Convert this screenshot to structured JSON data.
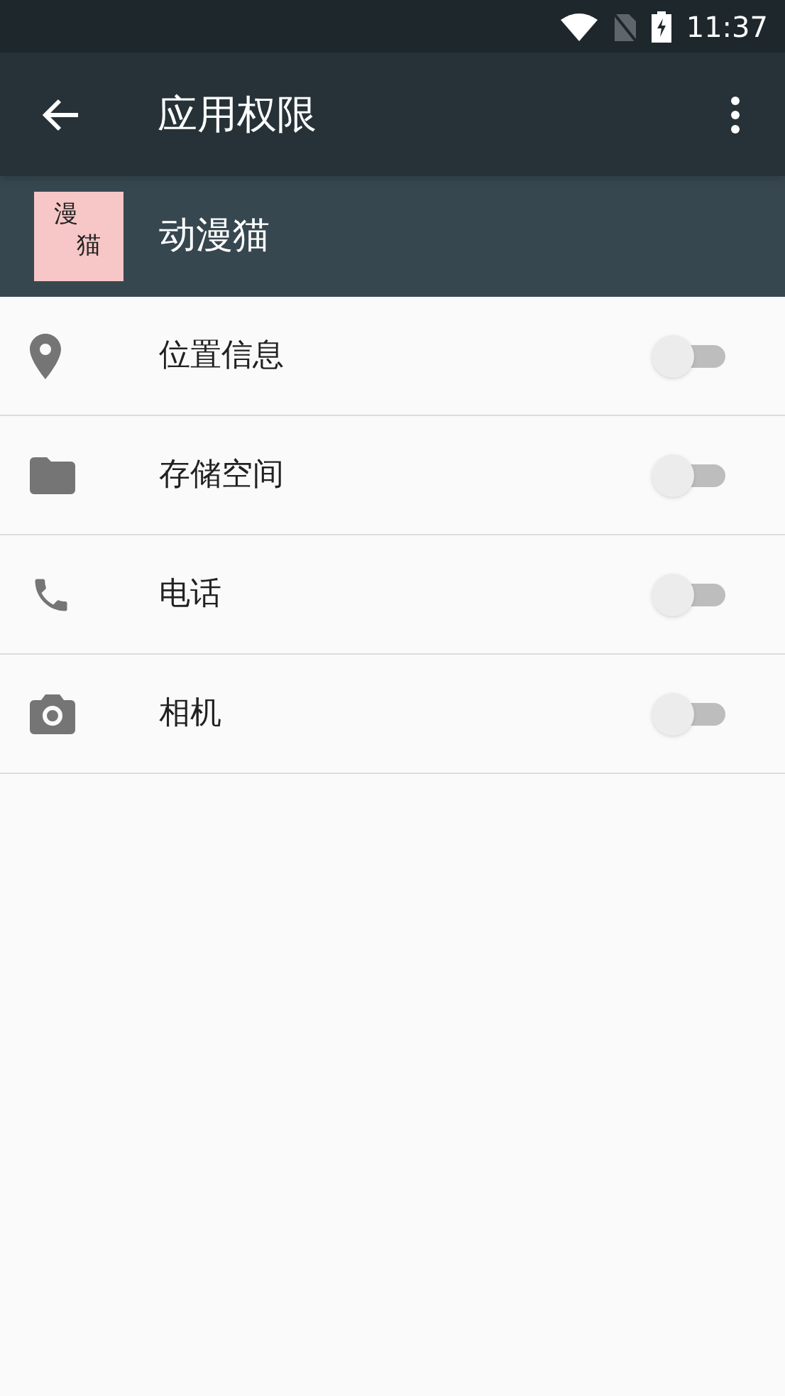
{
  "status_bar": {
    "time": "11:37"
  },
  "app_bar": {
    "title": "应用权限"
  },
  "app": {
    "name": "动漫猫",
    "icon_glyphs": [
      "漫",
      "猫"
    ]
  },
  "permissions": [
    {
      "kind": "location",
      "label": "位置信息",
      "checked": false
    },
    {
      "kind": "storage",
      "label": "存储空间",
      "checked": false
    },
    {
      "kind": "phone",
      "label": "电话",
      "checked": false
    },
    {
      "kind": "camera",
      "label": "相机",
      "checked": false
    }
  ]
}
